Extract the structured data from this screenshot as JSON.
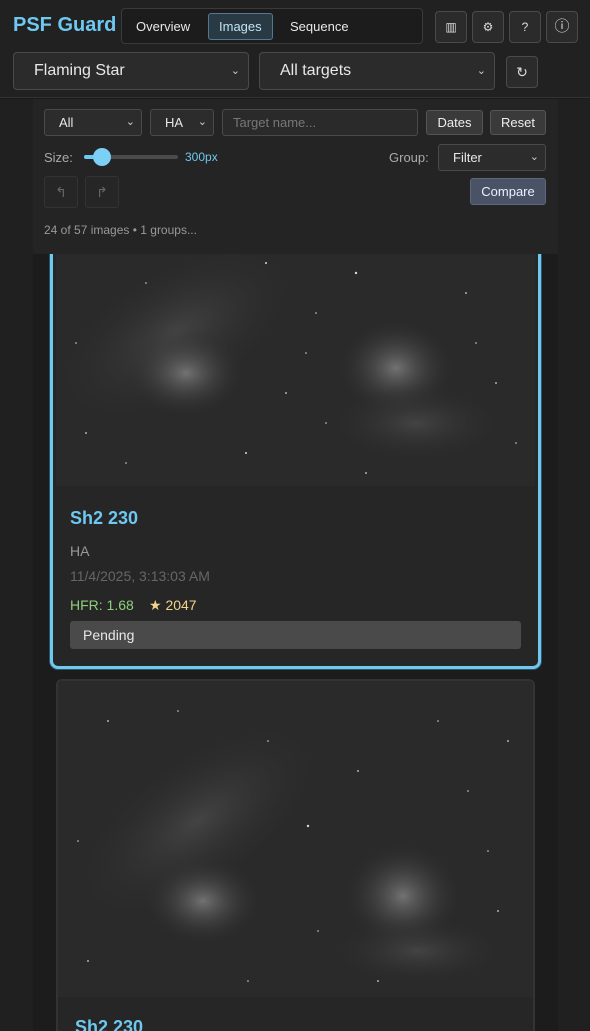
{
  "app": {
    "title": "PSF Guard"
  },
  "nav": {
    "tabs": [
      {
        "label": "Overview"
      },
      {
        "label": "Images"
      },
      {
        "label": "Sequence"
      }
    ],
    "icons": [
      {
        "name": "columns-icon",
        "glyph": "▥"
      },
      {
        "name": "gear-icon",
        "glyph": "⚙"
      },
      {
        "name": "help-icon",
        "glyph": "?"
      },
      {
        "name": "info-icon",
        "glyph": "ⓘ"
      }
    ]
  },
  "project_select": {
    "value": "Flaming Star"
  },
  "target_select": {
    "value": "All targets"
  },
  "refresh": {
    "glyph": "↻"
  },
  "filters": {
    "status": "All",
    "filter": "HA",
    "target_placeholder": "Target name...",
    "dates_label": "Dates",
    "reset_label": "Reset",
    "size_label": "Size:",
    "size_value": "300px",
    "size_fraction": 0.2,
    "group_label": "Group:",
    "group_value": "Filter",
    "undo_glyph": "↰",
    "redo_glyph": "↱",
    "compare_label": "Compare",
    "count_text": "24 of 57 images • 1 groups..."
  },
  "cards": [
    {
      "title": "Sh2 230",
      "filter": "HA",
      "date": "11/4/2025, 3:13:03 AM",
      "hfr": "HFR: 1.68",
      "stars": "★ 2047",
      "status": "Pending"
    },
    {
      "title": "Sh2 230"
    }
  ],
  "colors": {
    "accent": "#6ec8f0",
    "hfr": "#8fcf7a",
    "stars": "#f0d48a"
  }
}
